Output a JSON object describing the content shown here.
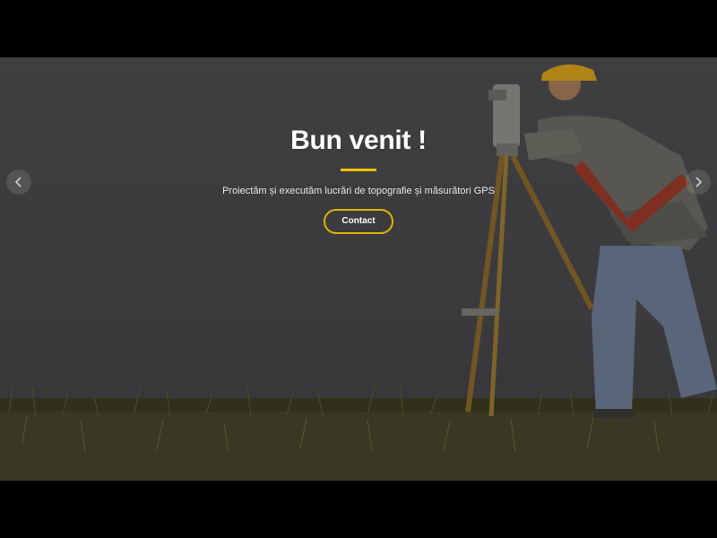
{
  "hero": {
    "title": "Bun venit !",
    "subtitle": "Proiectăm și executăm lucrări de topografie și măsurători GPS",
    "cta_label": "Contact"
  },
  "slider": {
    "prev_icon": "chevron-left-icon",
    "next_icon": "chevron-right-icon"
  },
  "colors": {
    "accent": "#f2c200",
    "overlay": "#000000",
    "background": "#000000"
  }
}
